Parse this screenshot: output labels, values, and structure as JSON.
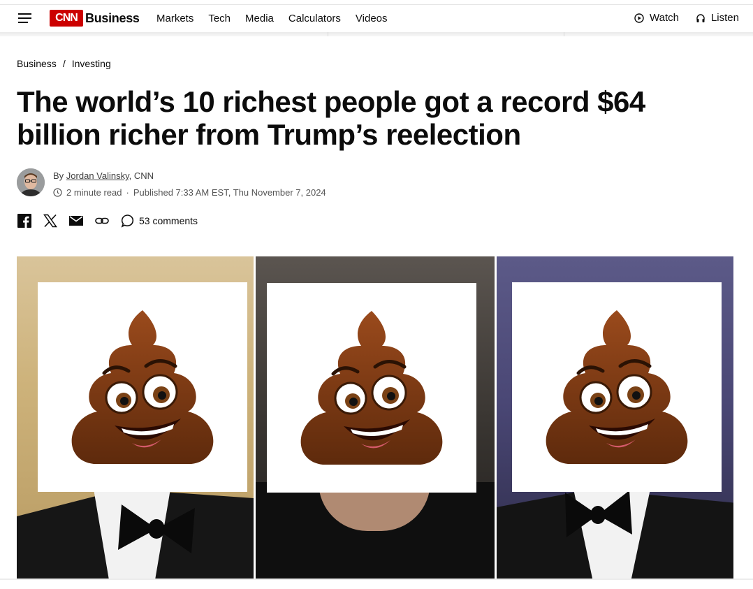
{
  "header": {
    "logo_text": "CNN",
    "brand": "Business",
    "nav": [
      "Markets",
      "Tech",
      "Media",
      "Calculators",
      "Videos"
    ],
    "watch": "Watch",
    "listen": "Listen",
    "accent_color": "#cc0000"
  },
  "breadcrumb": {
    "first": "Business",
    "separator": "/",
    "second": "Investing"
  },
  "article": {
    "headline": "The world’s 10 richest people got a record $64 billion richer from Trump’s reelection",
    "by_prefix": "By",
    "author": "Jordan Valinsky",
    "outlet": ", CNN",
    "read_time": "2 minute read",
    "dot": "·",
    "published": "Published 7:33 AM EST, Thu November 7, 2024"
  },
  "share": {
    "icons": [
      "facebook-icon",
      "x-icon",
      "email-icon",
      "link-icon",
      "comment-icon"
    ],
    "comments": "53 comments"
  },
  "hero": {
    "panels": 3,
    "overlay_icon": "smiling-poop-emoji"
  }
}
